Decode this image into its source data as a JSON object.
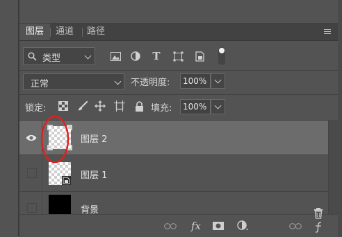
{
  "tabs": [
    {
      "label": "图层",
      "active": true
    },
    {
      "label": "通道",
      "active": false
    },
    {
      "label": "路径",
      "active": false
    }
  ],
  "filter": {
    "kind_label": "类型",
    "icons": [
      "image-filter-icon",
      "adjustment-filter-icon",
      "type-filter-icon",
      "shape-filter-icon",
      "smart-object-filter-icon",
      "filter-toggle-icon"
    ]
  },
  "blend": {
    "mode": "正常",
    "opacity_label": "不透明度:",
    "opacity_value": "100%"
  },
  "lock": {
    "label": "锁定:",
    "icons": [
      "lock-transparent-icon",
      "lock-paint-icon",
      "lock-position-icon",
      "lock-artboard-icon",
      "lock-all-icon"
    ],
    "fill_label": "填充:",
    "fill_value": "100%"
  },
  "layers": [
    {
      "name": "图层 2",
      "visible": true,
      "selected": true
    },
    {
      "name": "图层 1",
      "visible": false,
      "selected": false
    },
    {
      "name": "背景",
      "visible": false,
      "selected": false
    }
  ],
  "bottom_bar": {
    "fx_label": "fx",
    "icons": [
      "link-layers-icon",
      "fx-icon",
      "add-mask-icon",
      "adjustment-layer-icon",
      "link-icon",
      "trash-icon"
    ]
  },
  "colors": {
    "panel_bg": "#535353",
    "selected_row": "#6c6c6c",
    "annotation_circle": "#e02020"
  }
}
